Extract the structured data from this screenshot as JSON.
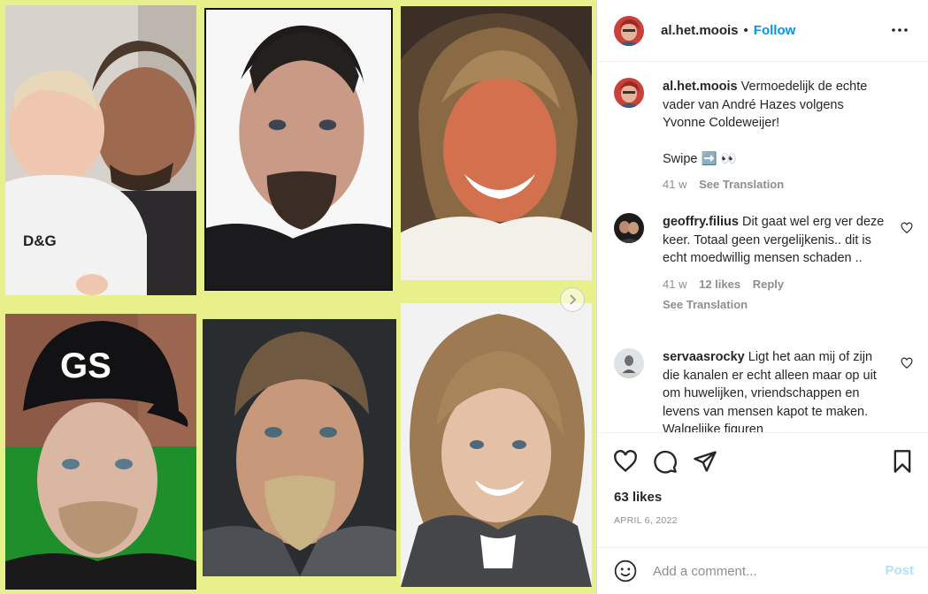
{
  "post": {
    "username": "al.het.moois",
    "separator": "•",
    "follow_label": "Follow",
    "more_icon": "more-horizontal-icon"
  },
  "caption": {
    "username": "al.het.moois",
    "text": "Vermoedelijk de echte vader van André Hazes volgens Yvonne Coldeweijer!",
    "text2": "Swipe ➡️ 👀",
    "time": "41 w",
    "translate": "See Translation"
  },
  "comments": [
    {
      "username": "geoffry.filius",
      "text": "Dit gaat wel erg ver deze keer. Totaal geen vergelijkenis.. dit is echt moedwillig mensen schaden ..",
      "time": "41 w",
      "likes": "12 likes",
      "reply": "Reply",
      "translate": "See Translation"
    },
    {
      "username": "servaasrocky",
      "text": "Ligt het aan mij of zijn die kanalen er echt alleen maar op uit om huwelijken, vriendschappen en levens van mensen kapot te maken. Walgelijke figuren"
    }
  ],
  "actions": {
    "like_icon": "heart-icon",
    "comment_icon": "comment-icon",
    "share_icon": "send-icon",
    "save_icon": "bookmark-icon",
    "likes": "63 likes",
    "date": "APRIL 6, 2022"
  },
  "composer": {
    "placeholder": "Add a comment...",
    "post_label": "Post"
  },
  "media": {
    "baby_shirt_text": "D&G",
    "cap_logo_text": "GS"
  },
  "colors": {
    "accent": "#0095f6",
    "post_disabled": "#b2dffc",
    "collage_border": "#e7f08a"
  }
}
